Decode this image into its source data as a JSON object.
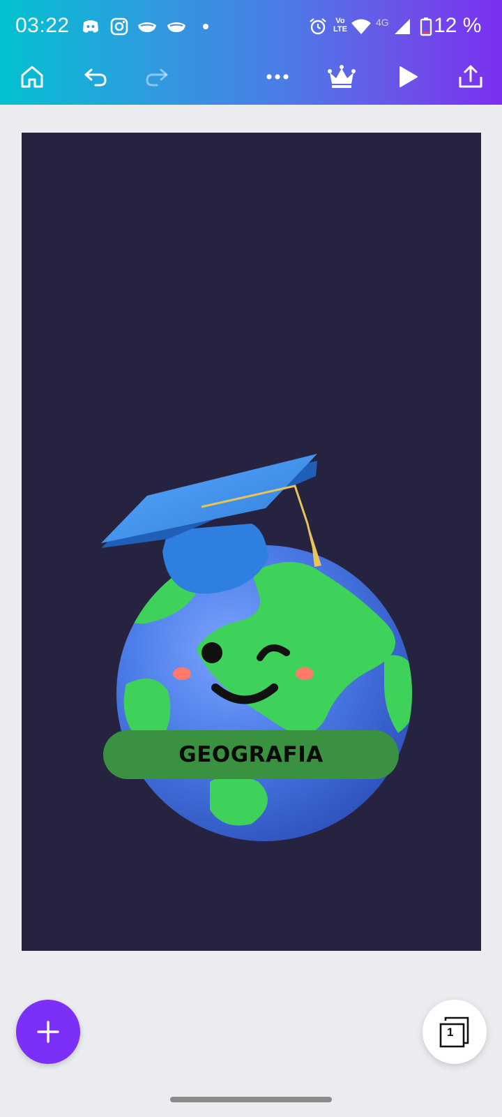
{
  "status_bar": {
    "time": "03:22",
    "notification_icons": [
      "discord-icon",
      "instagram-icon",
      "mask-icon",
      "mask-icon"
    ],
    "network": {
      "volte_top": "Vo",
      "volte_bottom": "LTE",
      "network_type": "4G"
    },
    "battery_text": "12 %"
  },
  "toolbar": {
    "icons": [
      "home-icon",
      "undo-icon",
      "redo-icon",
      "more-icon",
      "crown-icon",
      "play-icon",
      "share-icon"
    ]
  },
  "design": {
    "label": "GEOGRAFIA",
    "background_color": "#262340"
  },
  "bottom": {
    "page_count": "1"
  },
  "colors": {
    "accent": "#7b2ff7",
    "gradient_start": "#03c1d0",
    "gradient_end": "#7b2ff0"
  }
}
